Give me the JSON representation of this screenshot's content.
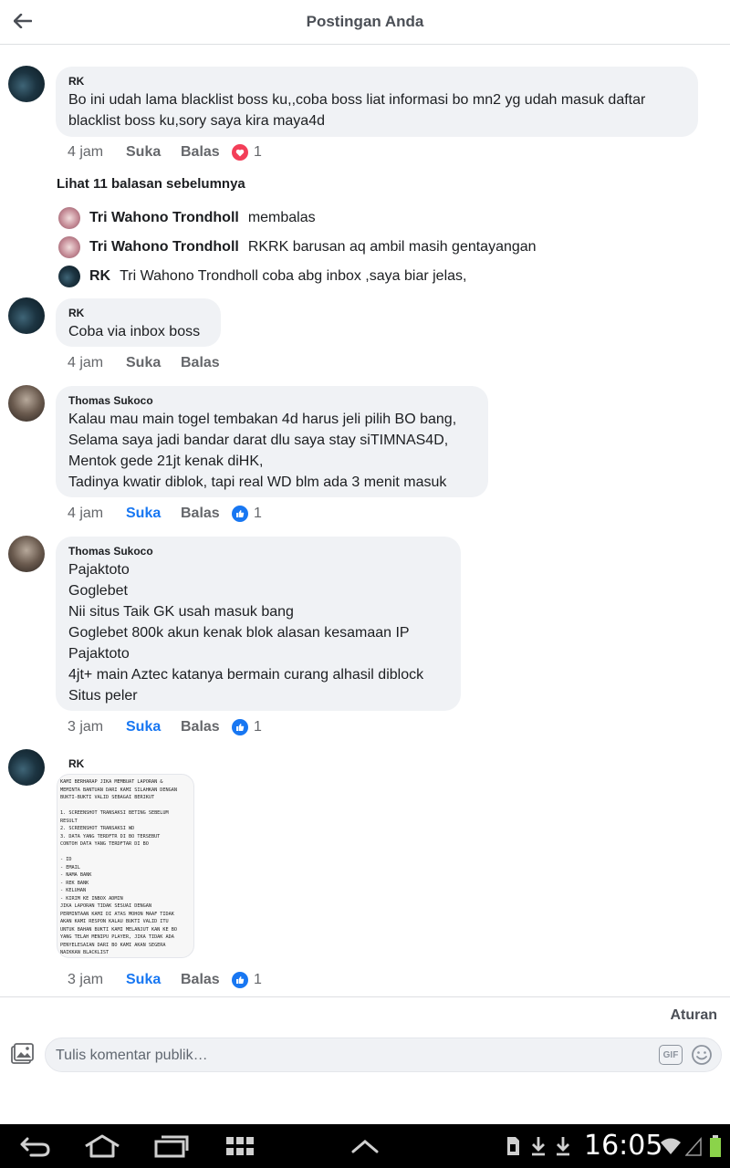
{
  "header": {
    "title": "Postingan Anda",
    "back_icon": "arrow-left-icon"
  },
  "comments": [
    {
      "author": "RK",
      "text": "Bo ini udah lama blacklist boss ku,,coba boss liat informasi bo mn2 yg udah masuk daftar\nblacklist boss ku,sory saya kira maya4d",
      "time": "4 jam",
      "like": "Suka",
      "reply": "Balas",
      "reaction": "love",
      "reaction_count": "1"
    },
    {
      "author": "RK",
      "text": "Coba via inbox boss",
      "time": "4 jam",
      "like": "Suka",
      "reply": "Balas"
    },
    {
      "author": "Thomas Sukoco",
      "text": "Kalau mau main togel tembakan 4d harus jeli pilih BO bang,\nSelama saya jadi bandar darat dlu saya stay siTIMNAS4D,\nMentok gede 21jt kenak diHK,\nTadinya kwatir diblok, tapi real WD blm ada 3 menit masuk",
      "time": "4 jam",
      "like": "Suka",
      "reply": "Balas",
      "reaction": "like",
      "reaction_count": "1"
    },
    {
      "author": "Thomas Sukoco",
      "text": "Pajaktoto\nGoglebet\nNii situs Taik GK usah masuk bang\nGoglebet 800k akun kenak blok alasan kesamaan IP\nPajaktoto\n4jt+ main Aztec katanya bermain curang alhasil diblock\nSitus peler",
      "time": "3 jam",
      "like": "Suka",
      "reply": "Balas",
      "reaction": "like",
      "reaction_count": "1"
    },
    {
      "author": "RK",
      "image_text": "KAMI BERHARAP JIKA MEMBUAT LAPORAN &\nMEMINTA BANTUAN DARI KAMI SILAHKAN DENGAN\nBUKTI-BUKTI VALID SEBAGAI BERIKUT\n\n1. SCREENSHOT TRANSAKSI BETING SEBELUM\nRESULT\n2. SCREENSHOT TRANSAKSI WD\n3. DATA YANG TERDFTR DI BO TERSEBUT\nCONTOH DATA YANG TERDFTAR DI BO\n\n- ID\n- EMAIL\n- NAMA BANK\n- REK BANK\n- KELUHAN\n- KIRIM KE INBOX ADMIN\nJIKA LAPORAN TIDAK SESUAI DENGAN\nPERMINTAAN KAMI DI ATAS MOHON MAAF TIDAK\nAKAN KAMI RESPON KALAU BUKTI VALID ITU\nUNTUK BAHAN BUKTI KAMI MELANJUT KAN KE BO\nYANG TELAH MENIPU PLAYER, JIKA TIDAK ADA\nPENYELESAIAN DARI BO KAMI AKAN SEGERA\nNAIKKAN BLACKLIST",
      "time": "3 jam",
      "like": "Suka",
      "reply": "Balas",
      "reaction": "like",
      "reaction_count": "1"
    }
  ],
  "more_replies": "Lihat 11 balasan sebelumnya",
  "mini_replies": [
    {
      "who": "Tri Wahono Trondholl",
      "text": "membalas"
    },
    {
      "who": "Tri Wahono Trondholl",
      "text": "RKRK  barusan aq ambil masih gentayangan"
    },
    {
      "who": "RK",
      "text": "Tri Wahono Trondholl coba abg inbox ,saya biar jelas,"
    }
  ],
  "footer": {
    "rules": "Aturan",
    "placeholder": "Tulis komentar publik…",
    "gif": "GIF"
  },
  "statusbar": {
    "clock": "16:05"
  },
  "colors": {
    "accent": "#1877f2",
    "love": "#f33e58",
    "bubble": "#f0f2f5"
  }
}
